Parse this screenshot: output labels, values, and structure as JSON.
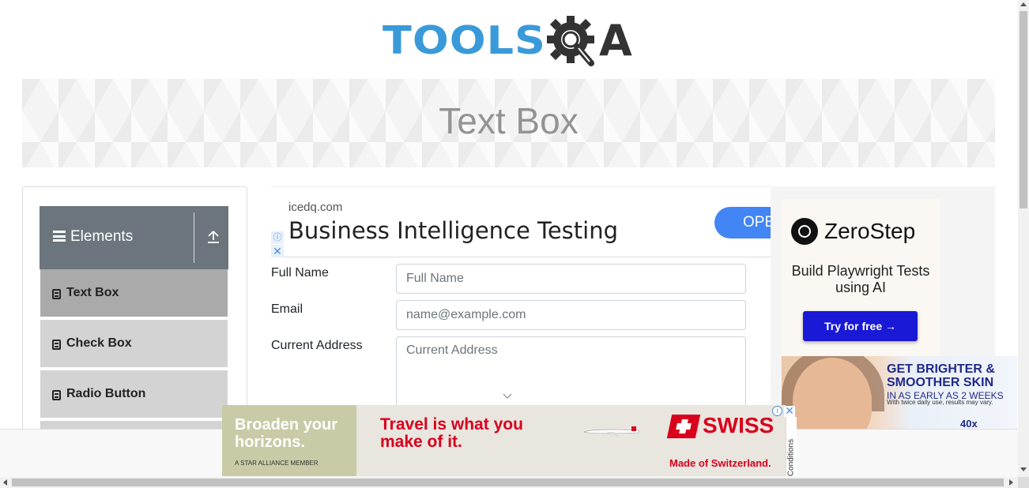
{
  "header": {
    "logo_tools": "TOOLS",
    "logo_a": "A"
  },
  "banner": {
    "title": "Text Box"
  },
  "sidebar": {
    "group_label": "Elements",
    "items": [
      {
        "label": "Text Box",
        "active": true
      },
      {
        "label": "Check Box",
        "active": false
      },
      {
        "label": "Radio Button",
        "active": false
      }
    ]
  },
  "ad_top": {
    "domain": "icedq.com",
    "headline": "Business Intelligence Testing",
    "button": "OPEN",
    "info": "ⓘ",
    "close": "✕"
  },
  "form": {
    "full_name_label": "Full Name",
    "full_name_placeholder": "Full Name",
    "email_label": "Email",
    "email_placeholder": "name@example.com",
    "address_label": "Current Address",
    "address_placeholder": "Current Address"
  },
  "ad_right": {
    "brand": "ZeroStep",
    "tagline": "Build Playwright Tests using AI",
    "button": "Try for free →"
  },
  "ad_skin": {
    "headline": "GET BRIGHTER & SMOOTHER SKIN",
    "sub": "IN AS EARLY AS 2 WEEKS",
    "fine": "With twice daily use, results may vary.",
    "badge": "40x"
  },
  "ad_bottom": {
    "left_text": "Broaden your horizons.",
    "star": "A STAR ALLIANCE MEMBER",
    "travel": "Travel is what you make of it.",
    "brand": "SWISS",
    "made": "Made of Switzerland.",
    "conditions": "Conditions",
    "info": "i",
    "close": "✕"
  },
  "colors": {
    "accent_blue": "#3a9ad9",
    "group_header": "#6c757d",
    "active_item": "#aaaaaa",
    "swiss_red": "#d8001c"
  }
}
